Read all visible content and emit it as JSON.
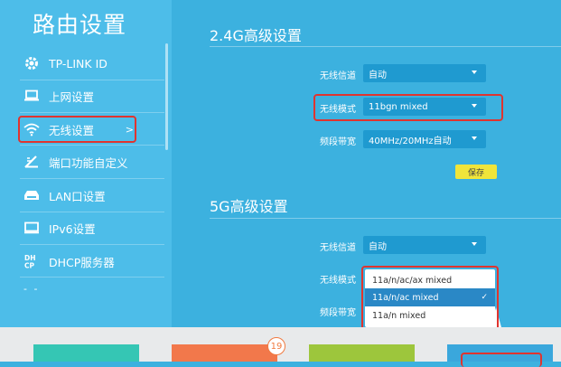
{
  "sidebar": {
    "title": "路由设置",
    "items": [
      {
        "label": "TP-LINK ID",
        "icon": "gear-icon"
      },
      {
        "label": "上网设置",
        "icon": "laptop-icon"
      },
      {
        "label": "无线设置",
        "icon": "wifi-icon",
        "arrow": ">"
      },
      {
        "label": "端口功能自定义",
        "icon": "ports-icon"
      },
      {
        "label": "LAN口设置",
        "icon": "lan-icon"
      },
      {
        "label": "IPv6设置",
        "icon": "monitor-icon"
      },
      {
        "label": "DHCP服务器",
        "icon": "dhcp-icon"
      }
    ],
    "more": "- -"
  },
  "wifi24": {
    "title": "2.4G高级设置",
    "channel_label": "无线信道",
    "channel_value": "自动",
    "mode_label": "无线模式",
    "mode_value": "11bgn mixed",
    "bandwidth_label": "频段带宽",
    "bandwidth_value": "40MHz/20MHz自动",
    "save_label": "保存"
  },
  "wifi5": {
    "title": "5G高级设置",
    "channel_label": "无线信道",
    "channel_value": "自动",
    "mode_label": "无线模式",
    "bandwidth_label": "频段带宽",
    "mode_options": [
      "11a/n/ac/ax mixed",
      "11a/n/ac mixed",
      "11a/n mixed"
    ],
    "selected_option": "11a/n/ac mixed",
    "check": "✓"
  },
  "footer": {
    "badge_count": "19"
  },
  "colors": {
    "background": "#3cb1df",
    "sidebar": "#4dbde9",
    "select": "#1f9ad0",
    "highlight": "#e0342f",
    "save": "#f1e53a",
    "tile_teal": "#35c6b4",
    "tile_orange": "#f2784b",
    "tile_green": "#9dc63c",
    "tile_blue": "#3aa7dc"
  }
}
